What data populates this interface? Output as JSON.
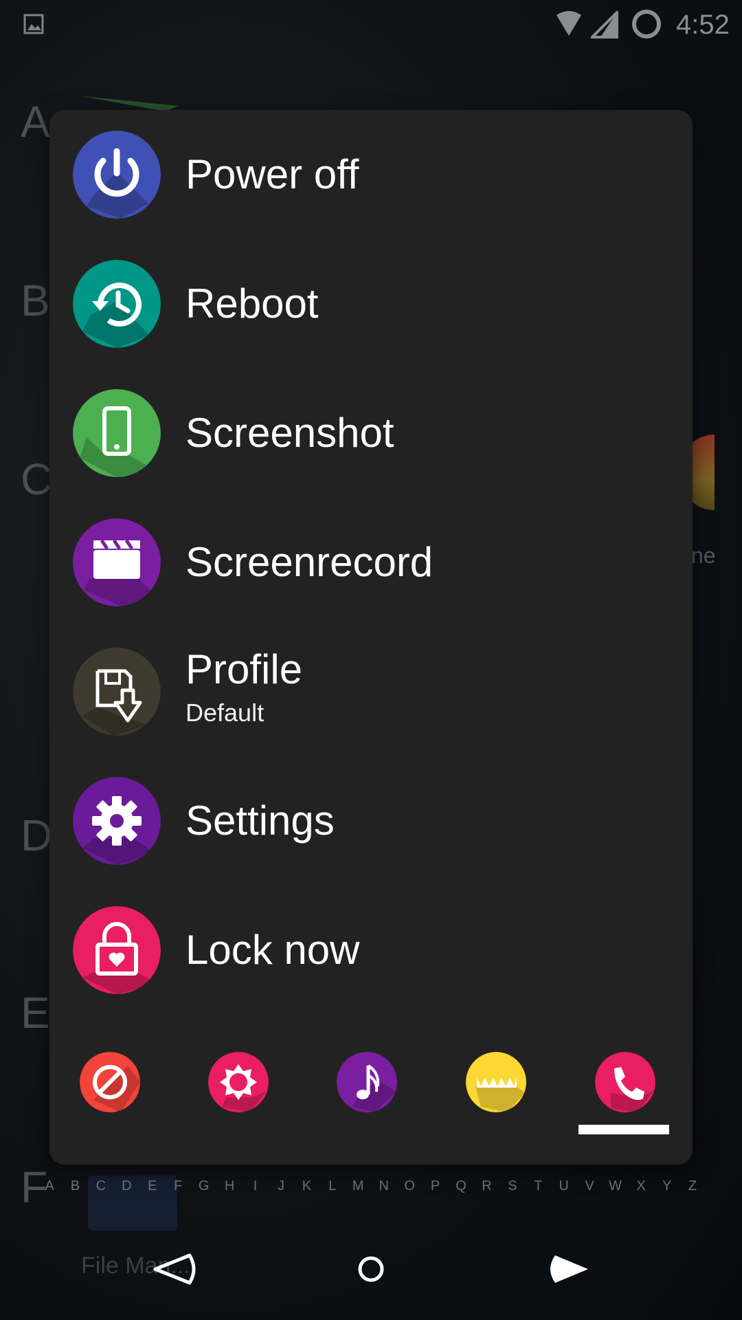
{
  "status_bar": {
    "time": "4:52",
    "icons": [
      "gallery-notification-icon",
      "wifi-icon",
      "signal-icon",
      "battery-circle-icon"
    ]
  },
  "background": {
    "section_letters": [
      "A",
      "B",
      "C",
      "D",
      "E",
      "F"
    ],
    "partial_app_label": "ne",
    "file_manager_label": "File Man...",
    "alphabet_index": [
      "A",
      "B",
      "C",
      "D",
      "E",
      "F",
      "G",
      "H",
      "I",
      "J",
      "K",
      "L",
      "M",
      "N",
      "O",
      "P",
      "Q",
      "R",
      "S",
      "T",
      "U",
      "V",
      "W",
      "X",
      "Y",
      "Z"
    ]
  },
  "power_menu": {
    "items": [
      {
        "label": "Power off",
        "icon": "power-icon",
        "color": "#3f51b5"
      },
      {
        "label": "Reboot",
        "icon": "restart-clock-icon",
        "color": "#009688"
      },
      {
        "label": "Screenshot",
        "icon": "phone-icon",
        "color": "#4caf50"
      },
      {
        "label": "Screenrecord",
        "icon": "clapperboard-icon",
        "color": "#7b1fa2"
      },
      {
        "label": "Profile",
        "sublabel": "Default",
        "icon": "save-profile-icon",
        "color": "#3e3a2e"
      },
      {
        "label": "Settings",
        "icon": "gear-icon",
        "color": "#6a1b9a"
      },
      {
        "label": "Lock now",
        "icon": "lock-heart-icon",
        "color": "#e91e63"
      }
    ],
    "quick_toggles": [
      {
        "name": "do-not-disturb-toggle",
        "icon": "block-icon",
        "color": "#f4433b"
      },
      {
        "name": "brightness-toggle",
        "icon": "sun-badge-icon",
        "color": "#e91e63"
      },
      {
        "name": "sound-toggle",
        "icon": "music-note-icon",
        "color": "#7b1fa2"
      },
      {
        "name": "vibrate-toggle",
        "icon": "zigzag-icon",
        "color": "#fdd835"
      },
      {
        "name": "ring-toggle",
        "icon": "phone-call-icon",
        "color": "#e91e63",
        "selected": true
      }
    ]
  },
  "nav_bar": {
    "buttons": [
      "back-icon",
      "home-icon",
      "recents-icon"
    ]
  }
}
